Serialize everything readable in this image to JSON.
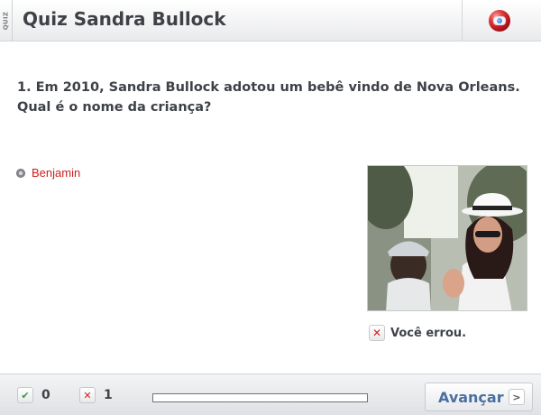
{
  "header": {
    "quiz_tag": "QUIZ",
    "title": "Quiz Sandra Bullock"
  },
  "question": {
    "text": "1. Em 2010, Sandra Bullock adotou um bebê vindo de Nova Orleans. Qual é o nome da criança?"
  },
  "options": [
    {
      "label": "Benjamin",
      "color": "#cc1f1f"
    }
  ],
  "result": {
    "icon": "x-mark-icon",
    "text": "Você errou."
  },
  "footer": {
    "correct_icon": "check-icon",
    "correct_count": "0",
    "wrong_icon": "x-mark-icon",
    "wrong_count": "1",
    "progress_fraction": 0,
    "next_label": "Avançar",
    "next_icon": "chevron-right-icon"
  },
  "colors": {
    "accent_blue": "#4a6fa0",
    "error_red": "#d42020",
    "correct_green": "#3a9a3a"
  }
}
